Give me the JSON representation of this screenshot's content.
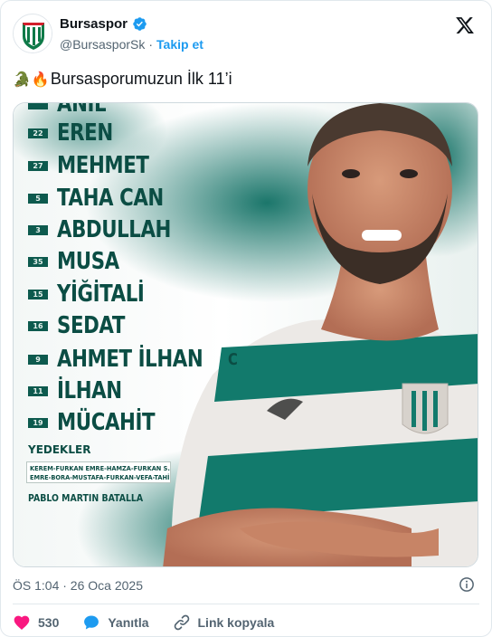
{
  "account": {
    "name": "Bursaspor",
    "handle": "@BursasporSk",
    "separator": "·",
    "follow_label": "Takip et"
  },
  "tweet": {
    "emoji_1": "🐊",
    "emoji_2": "🔥",
    "text": "Bursasporumuzun İlk 11’i"
  },
  "lineup": {
    "players": [
      {
        "number": "",
        "name": "ANIL"
      },
      {
        "number": "22",
        "name": "EREN"
      },
      {
        "number": "27",
        "name": "MEHMET"
      },
      {
        "number": "5",
        "name": "TAHA CAN"
      },
      {
        "number": "3",
        "name": "ABDULLAH"
      },
      {
        "number": "35",
        "name": "MUSA"
      },
      {
        "number": "15",
        "name": "YİĞİTALİ"
      },
      {
        "number": "16",
        "name": "SEDAT"
      },
      {
        "number": "9",
        "name": "AHMET İLHAN"
      },
      {
        "number": "11",
        "name": "İLHAN"
      },
      {
        "number": "19",
        "name": "MÜCAHİT"
      }
    ],
    "captain_mark": "C",
    "subs_title": "YEDEKLER",
    "subs_line_1": "KEREM-FURKAN EMRE-HAMZA-FURKAN S.",
    "subs_line_2": "EMRE-BORA-MUSTAFA-FURKAN-VEFA-TAHİR",
    "coach": "PABLO MARTIN BATALLA"
  },
  "meta": {
    "timestamp": "ÖS 1:04 · 26 Oca 2025"
  },
  "actions": {
    "likes": "530",
    "reply_label": "Yanıtla",
    "copy_link_label": "Link kopyala"
  },
  "colors": {
    "brand_green": "#0b4d44",
    "link_blue": "#1d9bf0",
    "like_red": "#f91880"
  }
}
